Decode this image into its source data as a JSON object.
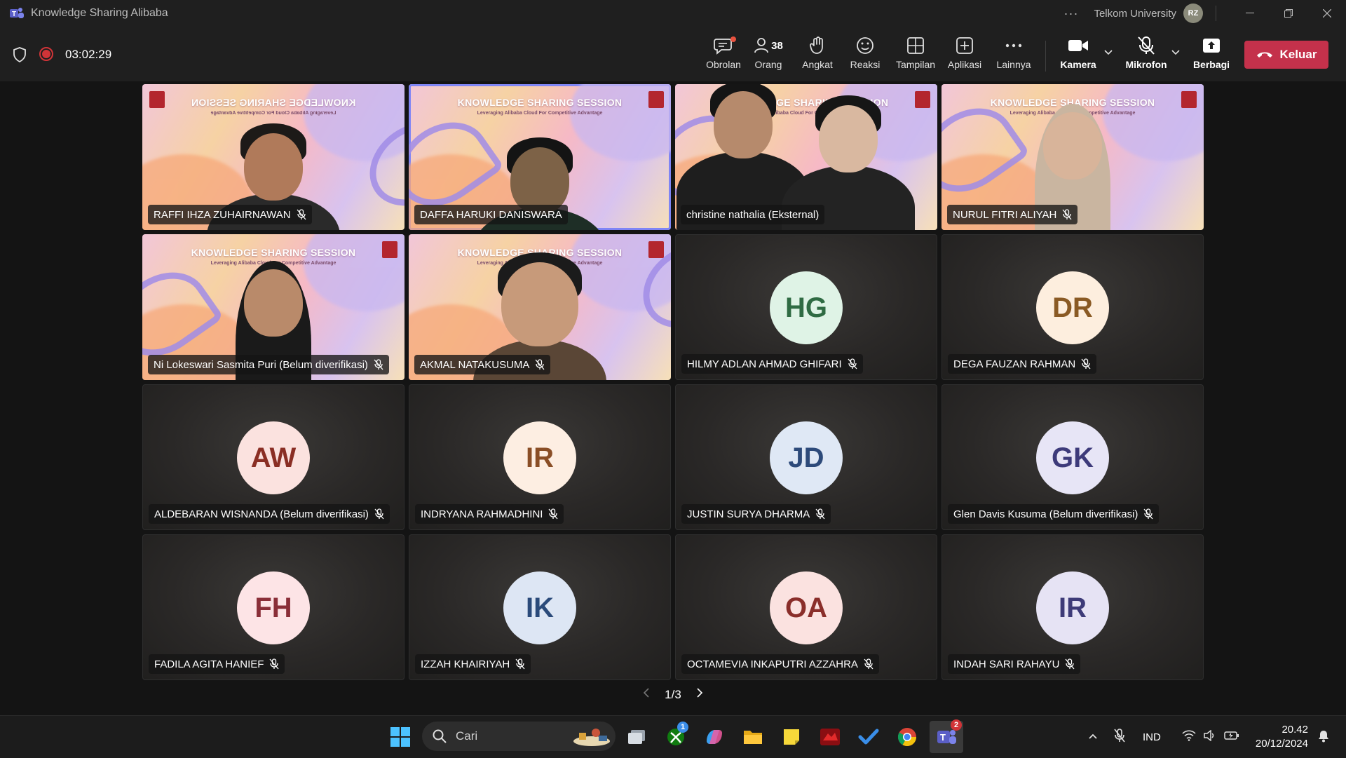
{
  "window": {
    "title": "Knowledge Sharing Alibaba",
    "org": "Telkom University",
    "user_initials": "RZ"
  },
  "meeting": {
    "timer": "03:02:29",
    "toolbar": {
      "chat": "Obrolan",
      "people": "Orang",
      "people_count": "38",
      "raise": "Angkat",
      "react": "Reaksi",
      "view": "Tampilan",
      "apps": "Aplikasi",
      "more": "Lainnya",
      "camera": "Kamera",
      "mic": "Mikrofon",
      "share": "Berbagi",
      "leave": "Keluar"
    }
  },
  "video_banner": "KNOWLEDGE SHARING SESSION",
  "video_banner_sub": "Leveraging Alibaba Cloud For Competitive Advantage",
  "participants": [
    {
      "name": "RAFFI IHZA ZUHAIRNAWAN",
      "type": "video",
      "muted": true
    },
    {
      "name": "DAFFA HARUKI DANISWARA",
      "type": "video",
      "muted": false,
      "active": true
    },
    {
      "name": "christine nathalia (Eksternal)",
      "type": "video",
      "muted": false
    },
    {
      "name": "NURUL FITRI ALIYAH",
      "type": "video",
      "muted": true
    },
    {
      "name": "Ni Lokeswari Sasmita Puri (Belum diverifikasi)",
      "type": "video",
      "muted": true
    },
    {
      "name": "AKMAL NATAKUSUMA",
      "type": "video",
      "muted": true
    },
    {
      "name": "HILMY ADLAN AHMAD GHIFARI",
      "initials": "HG",
      "bg": "#dff3e6",
      "fg": "#2f6b43",
      "muted": true
    },
    {
      "name": "DEGA FAUZAN RAHMAN",
      "initials": "DR",
      "bg": "#fdeede",
      "fg": "#8a5a24",
      "muted": true
    },
    {
      "name": "ALDEBARAN WISNANDA (Belum diverifikasi)",
      "initials": "AW",
      "bg": "#fbe2df",
      "fg": "#8a2e24",
      "muted": true
    },
    {
      "name": "INDRYANA RAHMADHINI",
      "initials": "IR",
      "bg": "#fdeee2",
      "fg": "#8a4e26",
      "muted": true
    },
    {
      "name": "JUSTIN SURYA DHARMA",
      "initials": "JD",
      "bg": "#dfe8f5",
      "fg": "#2d4a7a",
      "muted": true
    },
    {
      "name": "Glen Davis Kusuma (Belum diverifikasi)",
      "initials": "GK",
      "bg": "#e7e5f6",
      "fg": "#3d3a7a",
      "muted": true
    },
    {
      "name": "FADILA AGITA HANIEF",
      "initials": "FH",
      "bg": "#fde4e6",
      "fg": "#8a2e38",
      "muted": true
    },
    {
      "name": "IZZAH KHAIRIYAH",
      "initials": "IK",
      "bg": "#dde6f4",
      "fg": "#2a4a7a",
      "muted": true
    },
    {
      "name": "OCTAMEVIA INKAPUTRI AZZAHRA",
      "initials": "OA",
      "bg": "#fbe2e0",
      "fg": "#8a2e2a",
      "muted": true
    },
    {
      "name": "INDAH SARI RAHAYU",
      "initials": "IR",
      "bg": "#e6e3f4",
      "fg": "#3e3b78",
      "muted": true
    }
  ],
  "pager": "1/3",
  "taskbar": {
    "search_placeholder": "Cari",
    "xbox_badge": "1",
    "teams_badge": "2",
    "language": "IND",
    "time": "20.42",
    "date": "20/12/2024"
  },
  "colors": {
    "accent": "#7f85f5",
    "leave": "#c4314b",
    "recording": "#d13438"
  }
}
